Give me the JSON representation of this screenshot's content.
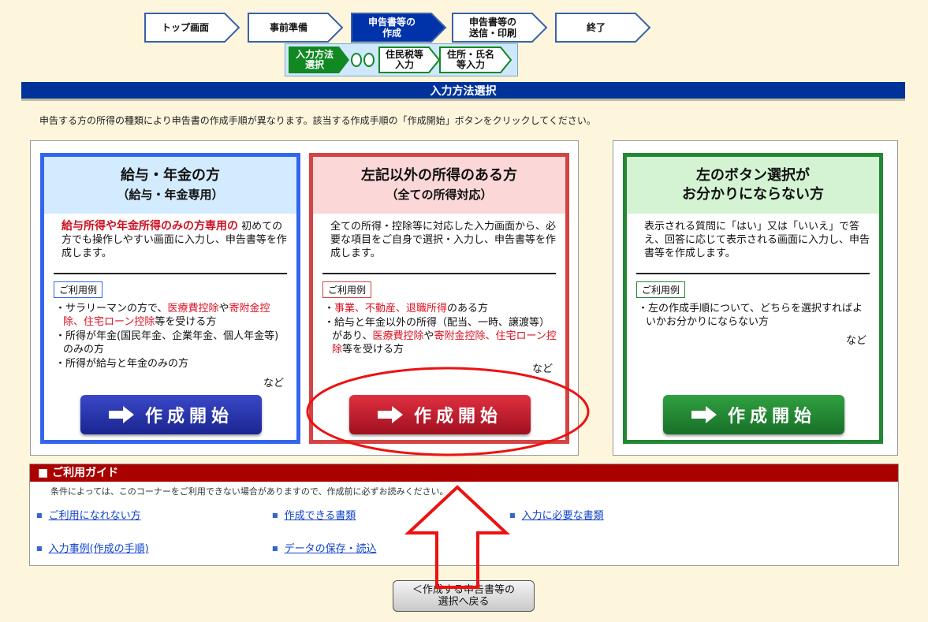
{
  "steps": [
    {
      "label": "トップ画面",
      "active": false
    },
    {
      "label": "事前準備",
      "active": false
    },
    {
      "label": "申告書等の\n作成",
      "active": true
    },
    {
      "label": "申告書等の\n送信・印刷",
      "active": false
    },
    {
      "label": "終了",
      "active": false
    }
  ],
  "substeps": [
    {
      "label": "入力方法\n選択",
      "active": true
    },
    {
      "label": "住民税等\n入力",
      "active": false
    },
    {
      "label": "住所・氏名\n等入力",
      "active": false
    }
  ],
  "section_title": "入力方法選択",
  "intro": "申告する方の所得の種類により申告書の作成手順が異なります。該当する作成手順の「作成開始」ボタンをクリックしてください。",
  "cards": {
    "salary": {
      "title": "給与・年金の方",
      "subtitle": "（給与・年金専用）",
      "desc_red": "給与所得や年金所得のみの方専用の",
      "desc": "初めての方でも操作しやすい画面に入力し、申告書等を作成します。",
      "usage": "ご利用例",
      "items": [
        {
          "pre": "サラリーマンの方で、",
          "h1": "医療費控除",
          "mid": "や",
          "h2": "寄附金控除、住宅ローン控除",
          "post": "等を受ける方"
        },
        {
          "text": "所得が年金(国民年金、企業年金、個人年金等)のみの方"
        },
        {
          "text": "所得が給与と年金のみの方"
        }
      ],
      "etc": "など",
      "button": "作成開始"
    },
    "other": {
      "title": "左記以外の所得のある方",
      "subtitle": "（全ての所得対応）",
      "desc": "全ての所得・控除等に対応した入力画面から、必要な項目をご自身で選択・入力し、申告書等を作成します。",
      "usage": "ご利用例",
      "item1_hl": "事業、不動産、退職所得",
      "item1_post": "のある方",
      "item2_pre": "給与と年金以外の所得（配当、一時、譲渡等）があり、",
      "item2_h1": "医療費控除",
      "item2_mid": "や",
      "item2_h2": "寄附金控除、住宅ローン控除",
      "item2_post": "等を受ける方",
      "etc": "など",
      "button": "作成開始"
    },
    "unknown": {
      "title": "左のボタン選択が",
      "subtitle": "お分かりにならない方",
      "desc": "表示される質問に「はい」又は「いいえ」で答え、回答に応じて表示される画面に入力し、申告書等を作成します。",
      "usage": "ご利用例",
      "item1": "左の作成手順について、どちらを選択すればよいかお分かりにならない方",
      "etc": "など",
      "button": "作成開始"
    }
  },
  "guide": {
    "title": "ご利用ガイド",
    "note": "条件によっては、このコーナーをご利用できない場合がありますので、作成前に必ずお読みください。",
    "links": [
      "ご利用になれない方",
      "作成できる書類",
      "入力に必要な書類",
      "入力事例(作成の手順)",
      "データの保存・読込"
    ]
  },
  "back_button": "＜作成する申告書等の\n選択へ戻る",
  "colors": {
    "header_blue": "#003399",
    "guide_red": "#aa0000",
    "annotation_red": "#ee1111"
  }
}
